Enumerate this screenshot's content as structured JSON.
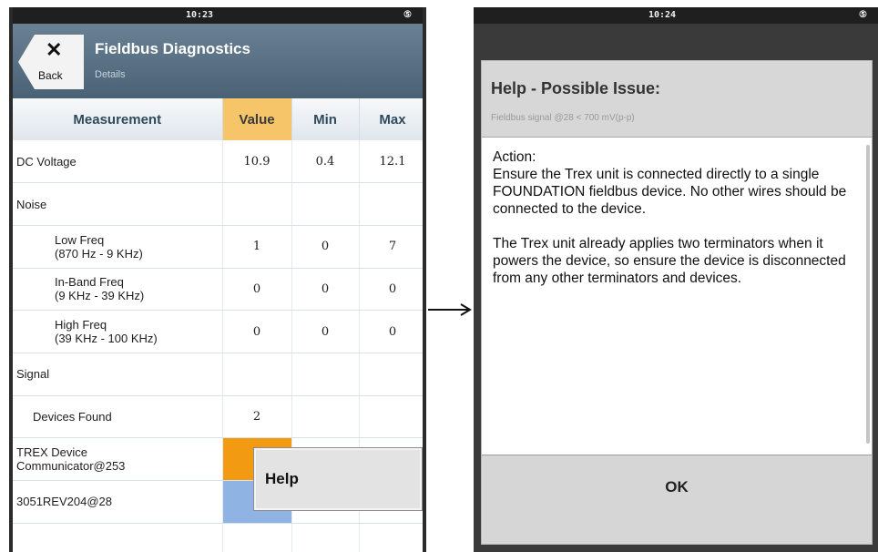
{
  "left": {
    "status_time": "10:23",
    "battery_glyph": "⑤",
    "back_label": "Back",
    "back_icon": "close-icon",
    "title": "Fieldbus Diagnostics",
    "subtitle": "Details",
    "columns": [
      "Measurement",
      "Value",
      "Min",
      "Max"
    ],
    "rows": {
      "dc": {
        "name": "DC Voltage",
        "value": "10.9",
        "min": "0.4",
        "max": "12.1"
      },
      "noise": {
        "name": "Noise"
      },
      "low": {
        "name1": "Low Freq",
        "name2": "(870 Hz - 9 KHz)",
        "value": "1",
        "min": "0",
        "max": "7"
      },
      "inband": {
        "name1": "In-Band Freq",
        "name2": "(9 KHz - 39 KHz)",
        "value": "0",
        "min": "0",
        "max": "0"
      },
      "high": {
        "name1": "High Freq",
        "name2": "(39 KHz - 100 KHz)",
        "value": "0",
        "min": "0",
        "max": "0"
      },
      "signal": {
        "name": "Signal"
      },
      "devices": {
        "name": "Devices Found",
        "value": "2"
      },
      "trex": {
        "name1": "TREX Device",
        "name2": "Communicator@253"
      },
      "rev": {
        "name": "3051REV204@28"
      }
    },
    "help_popup": "Help"
  },
  "right": {
    "status_time": "10:24",
    "battery_glyph": "⑤",
    "dialog_title": "Help - Possible Issue:",
    "dialog_subtitle": "Fieldbus signal @28 < 700 mV(p-p)",
    "action_label": "Action:",
    "paragraph1": "Ensure the Trex unit is connected directly to a single FOUNDATION fieldbus device. No other wires should be connected to the device.",
    "paragraph2": "The Trex unit already applies two terminators when it powers the device, so ensure the device is disconnected from any other terminators and devices.",
    "ok_label": "OK"
  },
  "colors": {
    "header_blue": "#55708a",
    "value_header": "#f7c569",
    "orange_cell": "#f39a13",
    "blue_cell": "#8fb3e3"
  }
}
